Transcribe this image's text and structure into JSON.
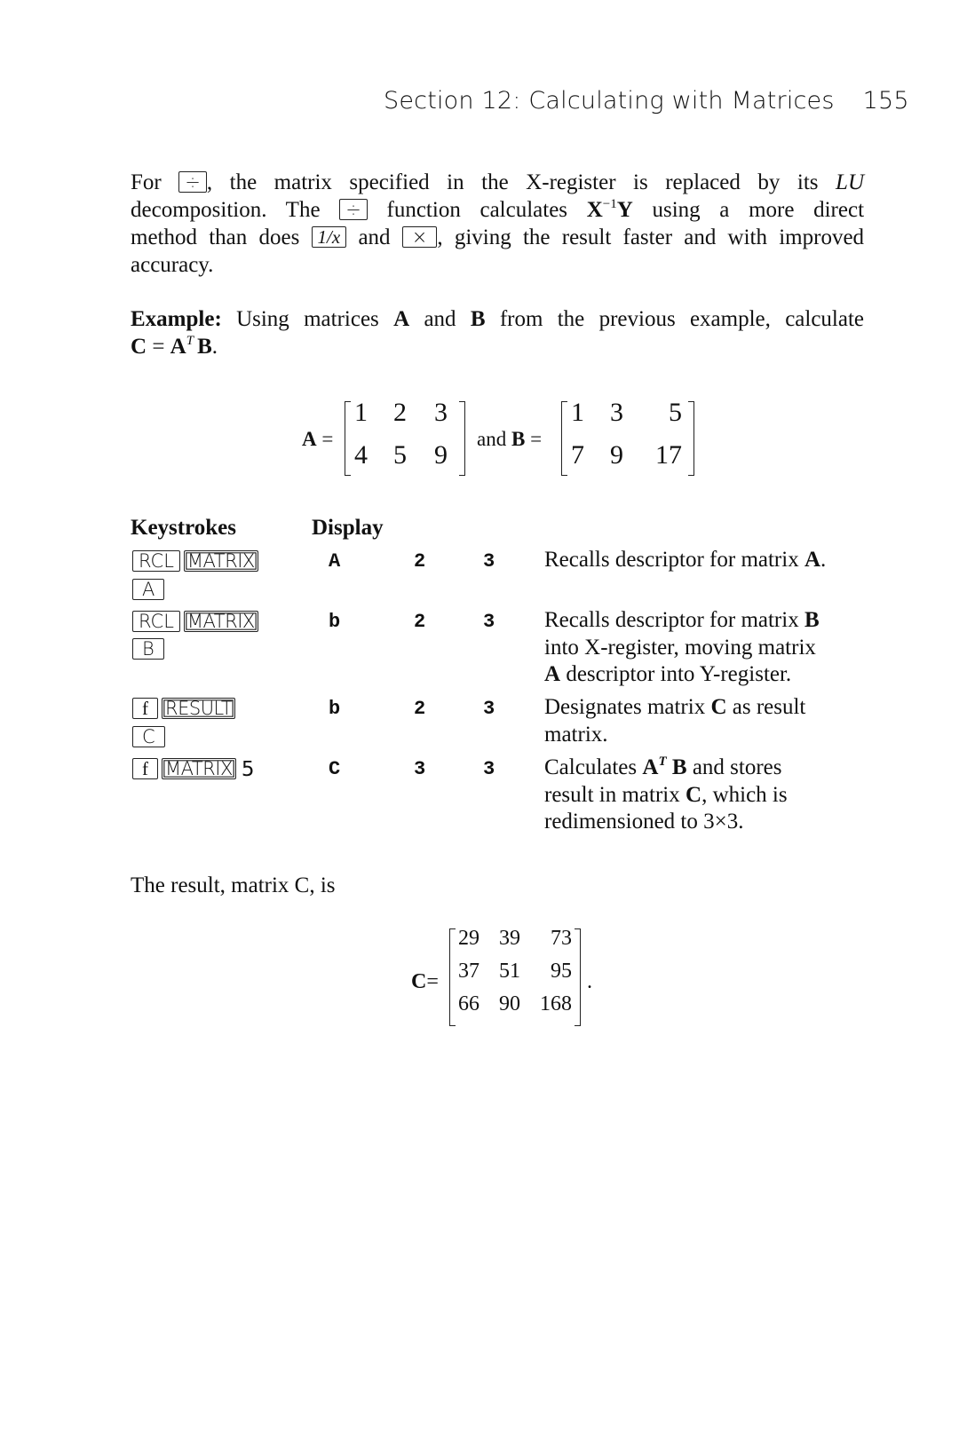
{
  "header": {
    "section_title": "Section 12: Calculating with Matrices",
    "page_number": "155"
  },
  "intro_paragraph": {
    "l1_a": "For",
    "key_divide": "÷",
    "l1_b": ", the matrix specified in the X-register is replaced by its",
    "l1_lu": "LU",
    "l2_a": "decomposition. The",
    "l2_b": "function calculates",
    "l2_x": "X",
    "l2_exp": "−1",
    "l2_y": "Y",
    "l2_c": "using a more direct",
    "l3_a": "method than does",
    "key_reciprocal": "1/x",
    "l3_b": "and",
    "key_multiply": "×",
    "l3_c": ", giving the result faster and with improved",
    "l4": "accuracy."
  },
  "example": {
    "label": "Example:",
    "l1_a": "Using matrices",
    "A": "A",
    "and": "and",
    "B": "B",
    "l1_b": "from the previous example, calculate",
    "l2_C": "C",
    "l2_eq": " = ",
    "l2_A": "A",
    "l2_T": "T",
    "l2_B": "B",
    "l2_end": "."
  },
  "matrices": {
    "A": {
      "label": "A",
      "eq": "=",
      "rows": [
        [
          "1",
          "2",
          "3"
        ],
        [
          "4",
          "5",
          "9"
        ]
      ]
    },
    "and_text": "and",
    "B": {
      "label": "B",
      "eq": "=",
      "rows": [
        [
          "1",
          "3",
          "5"
        ],
        [
          "7",
          "9",
          "17"
        ]
      ]
    }
  },
  "table": {
    "headers": {
      "keystrokes": "Keystrokes",
      "display": "Display"
    },
    "rows": [
      {
        "keys_line1": [
          "RCL",
          "MATRIX"
        ],
        "keys_line2": [
          "A"
        ],
        "display": [
          "A",
          "2",
          "3"
        ],
        "desc_lines": [
          {
            "t": "Recalls descriptor for matrix ",
            "b": "A",
            "e": "."
          }
        ]
      },
      {
        "keys_line1": [
          "RCL",
          "MATRIX"
        ],
        "keys_line2": [
          "B"
        ],
        "display": [
          "b",
          "2",
          "3"
        ],
        "desc_lines": [
          {
            "t": "Recalls descriptor for matrix ",
            "b": "B",
            "e": ""
          },
          {
            "t": "into X-register, moving matrix",
            "b": "",
            "e": ""
          },
          {
            "t": "",
            "b": "A",
            "e": " descriptor into Y-register."
          }
        ]
      },
      {
        "keys_line1": [
          "f",
          "RESULT"
        ],
        "keys_line2": [
          "C"
        ],
        "display": [
          "b",
          "2",
          "3"
        ],
        "desc_lines": [
          {
            "t": "Designates matrix ",
            "b": "C",
            "e": " as result"
          },
          {
            "t": "matrix.",
            "b": "",
            "e": ""
          }
        ]
      },
      {
        "keys_line1": [
          "f",
          "MATRIX"
        ],
        "keys_suffix": "5",
        "display": [
          "C",
          "3",
          "3"
        ],
        "desc_lines": [
          {
            "t": "Calculates ",
            "b": "A",
            "sup": "T",
            "b2": "B",
            "e": " and stores"
          },
          {
            "t": "result in matrix ",
            "b": "C",
            "e": ", which is"
          },
          {
            "t": "redimensioned to 3×3.",
            "b": "",
            "e": ""
          }
        ]
      }
    ]
  },
  "result": {
    "text": "The result, matrix C, is",
    "C": {
      "label": "C",
      "eq": "=",
      "rows": [
        [
          "29",
          "39",
          "73"
        ],
        [
          "37",
          "51",
          "95"
        ],
        [
          "66",
          "90",
          "168"
        ]
      ],
      "end": "."
    }
  }
}
